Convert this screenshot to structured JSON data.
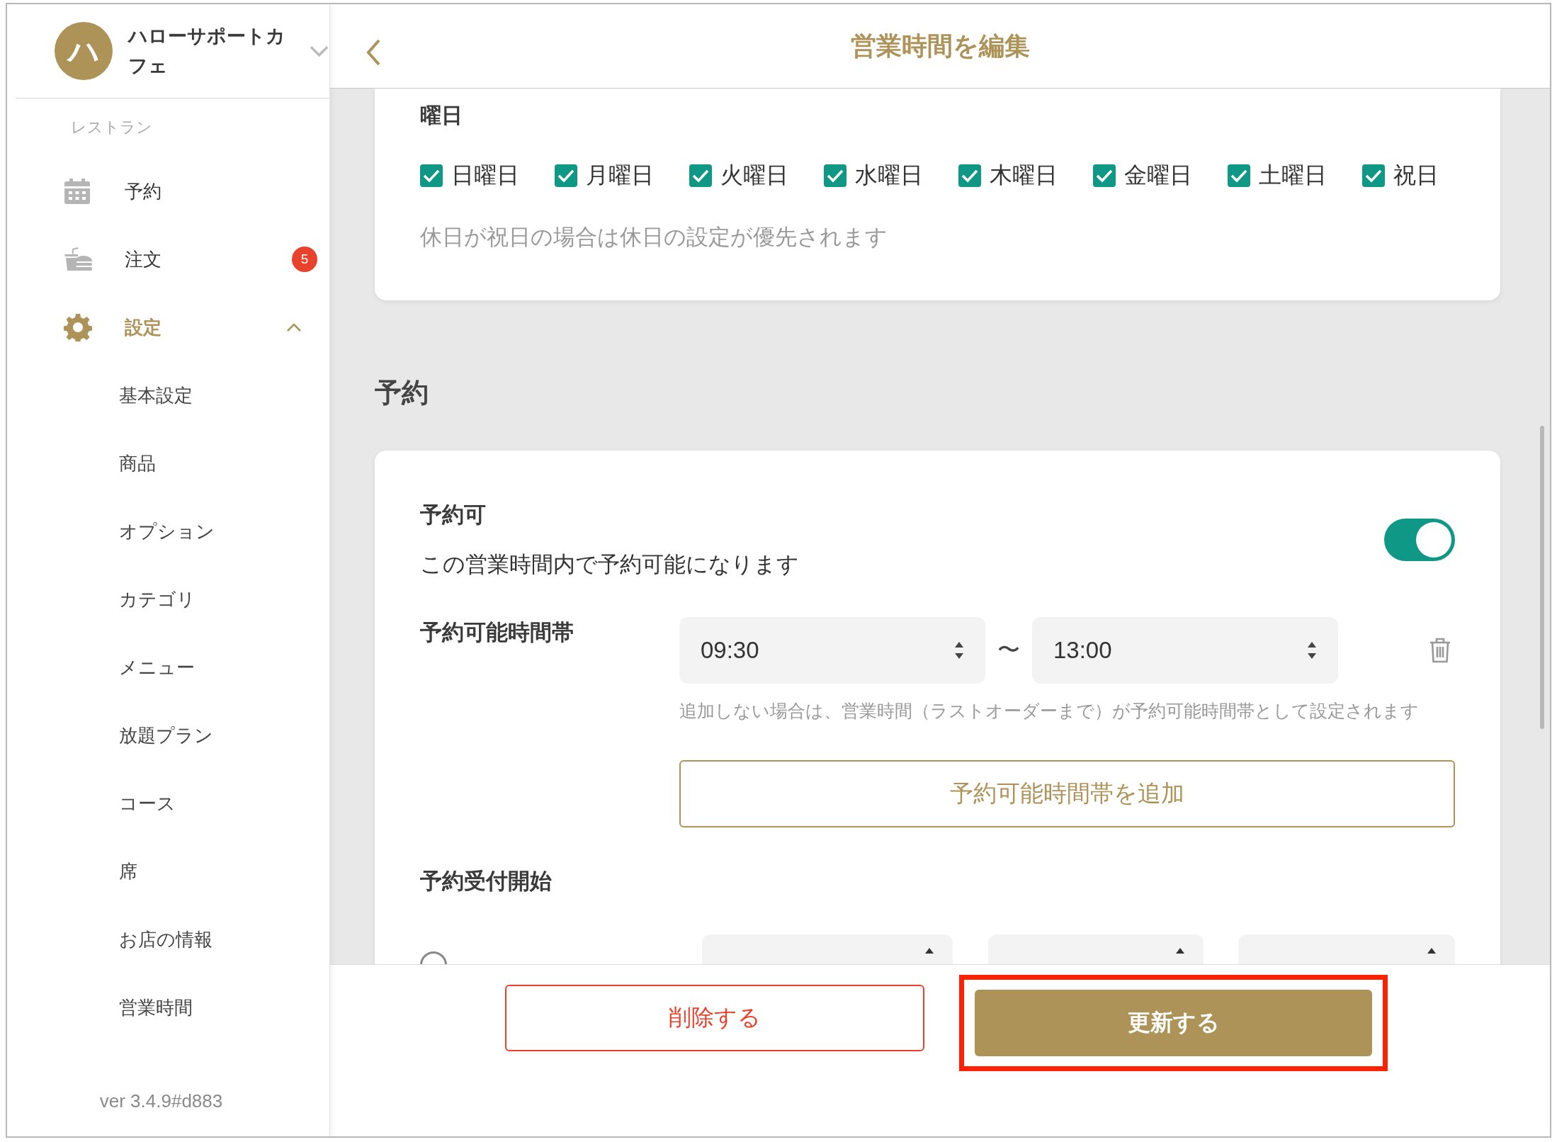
{
  "sidebar": {
    "avatar_initial": "ハ",
    "store_name": "ハローサポートカフェ",
    "section_label": "レストラン",
    "items": [
      {
        "label": "予約",
        "selected": false
      },
      {
        "label": "注文",
        "selected": false,
        "badge": "5"
      },
      {
        "label": "設定",
        "selected": true,
        "expanded": true,
        "children": [
          {
            "label": "基本設定",
            "selected": false
          },
          {
            "label": "商品",
            "selected": false
          },
          {
            "label": "オプション",
            "selected": false
          },
          {
            "label": "カテゴリ",
            "selected": false
          },
          {
            "label": "メニュー",
            "selected": false
          },
          {
            "label": "放題プラン",
            "selected": false
          },
          {
            "label": "コース",
            "selected": false
          },
          {
            "label": "席",
            "selected": false
          },
          {
            "label": "お店の情報",
            "selected": false
          },
          {
            "label": "営業時間",
            "selected": false
          }
        ]
      }
    ],
    "version": "ver 3.4.9#d883"
  },
  "header": {
    "title": "営業時間を編集"
  },
  "days": {
    "heading": "曜日",
    "options": [
      {
        "label": "日曜日",
        "checked": true
      },
      {
        "label": "月曜日",
        "checked": true
      },
      {
        "label": "火曜日",
        "checked": true
      },
      {
        "label": "水曜日",
        "checked": true
      },
      {
        "label": "木曜日",
        "checked": true
      },
      {
        "label": "金曜日",
        "checked": true
      },
      {
        "label": "土曜日",
        "checked": true
      },
      {
        "label": "祝日",
        "checked": true
      }
    ],
    "note": "休日が祝日の場合は休日の設定が優先されます"
  },
  "reservation": {
    "heading": "予約",
    "enabled": {
      "label": "予約可",
      "description": "この営業時間内で予約可能になります",
      "on": true
    },
    "time_slots": {
      "label": "予約可能時間帯",
      "slots": [
        {
          "start": "09:30",
          "separator": "〜",
          "end": "13:00"
        }
      ],
      "hint": "追加しない場合は、営業時間（ラストオーダーまで）が予約可能時間帯として設定されます",
      "add_button": "予約可能時間帯を追加"
    },
    "acceptance": {
      "label": "予約受付開始",
      "options": [
        {
          "selected": false
        }
      ]
    }
  },
  "footer": {
    "delete_button": "削除する",
    "update_button": "更新する",
    "update_highlighted": true
  }
}
